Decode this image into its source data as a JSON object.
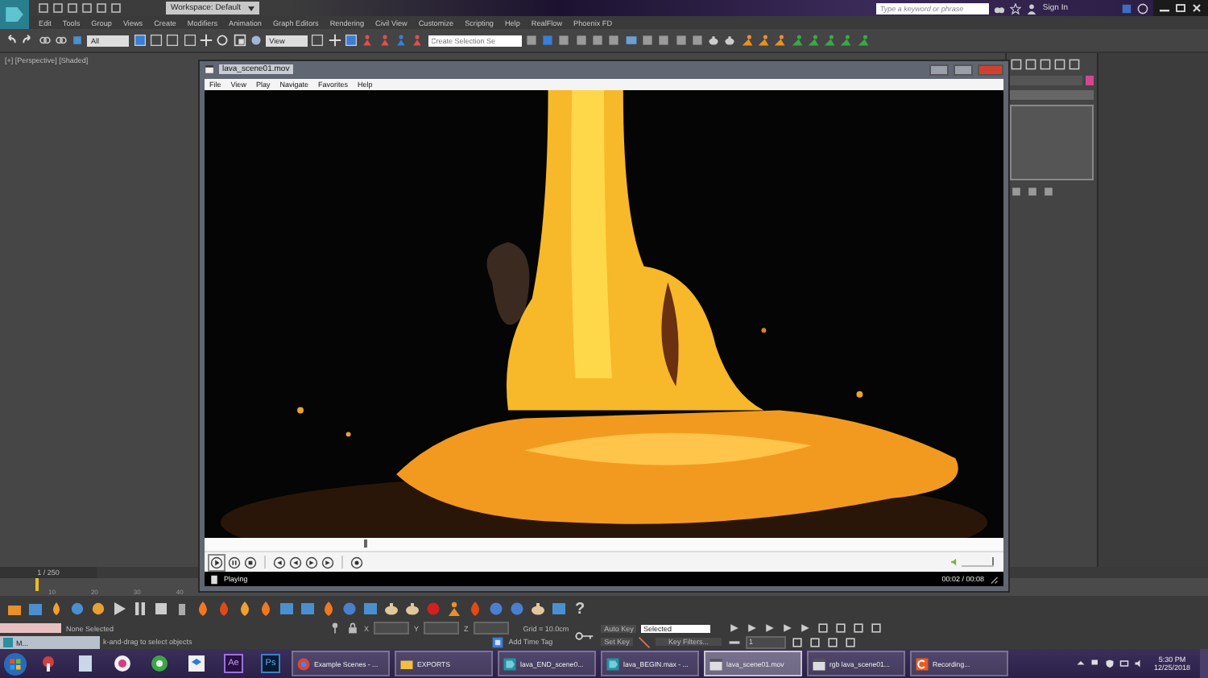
{
  "app": {
    "workspace": "Workspace: Default",
    "search": {
      "placeholder": "Type a keyword or phrase"
    },
    "sign_in": "Sign In"
  },
  "menu": [
    "Edit",
    "Tools",
    "Group",
    "Views",
    "Create",
    "Modifiers",
    "Animation",
    "Graph Editors",
    "Rendering",
    "Civil View",
    "Customize",
    "Scripting",
    "Help",
    "RealFlow",
    "Phoenix FD"
  ],
  "toolbar": {
    "selection_filter": "All",
    "reference_coordinate": "View",
    "named_selection": {
      "placeholder": "Create Selection Se"
    }
  },
  "viewport": {
    "label": "[+] [Perspective] [Shaded]"
  },
  "player": {
    "title": "lava_scene01.mov",
    "menu": [
      "File",
      "View",
      "Play",
      "Navigate",
      "Favorites",
      "Help"
    ],
    "seek": {
      "level": 0.2
    },
    "volume": {
      "level": 1
    },
    "status": "Playing",
    "time": "00:02 / 00:08"
  },
  "timeline": {
    "frame": "1 / 250",
    "level": 0,
    "ruler": [
      "10",
      "20",
      "30",
      "40"
    ]
  },
  "animation_toolbar": {
    "help": "?"
  },
  "status_bar": {
    "selection": "None Selected",
    "prompt": "k-and-drag to select objects",
    "coords": [
      "X",
      "Y",
      "Z"
    ],
    "grid": "Grid = 10.0cm",
    "add_time_tag": "Add Time Tag",
    "auto_key": "Auto Key",
    "key_mode": "Selected",
    "set_key": "Set Key",
    "key_filters": "Key Filters...",
    "current_frame": "1"
  },
  "minimized_window": {
    "title": "M..."
  },
  "taskbar": {
    "pinned_labels": [
      "Ae",
      "Ps"
    ],
    "tasks": [
      {
        "kind": "browser",
        "title": "Example Scenes - ...",
        "selected": false
      },
      {
        "kind": "folder",
        "title": "EXPORTS",
        "selected": false
      },
      {
        "kind": "max",
        "title": "lava_END_scene0...",
        "selected": false
      },
      {
        "kind": "max",
        "title": "lava_BEGIN.max - ...",
        "selected": false
      },
      {
        "kind": "video",
        "title": "lava_scene01.mov",
        "selected": true
      },
      {
        "kind": "video",
        "title": "rgb lava_scene01...",
        "selected": false
      },
      {
        "kind": "recorder",
        "title": "Recording...",
        "selected": false
      }
    ],
    "time": "5:30 PM",
    "date": "12/25/2018"
  }
}
